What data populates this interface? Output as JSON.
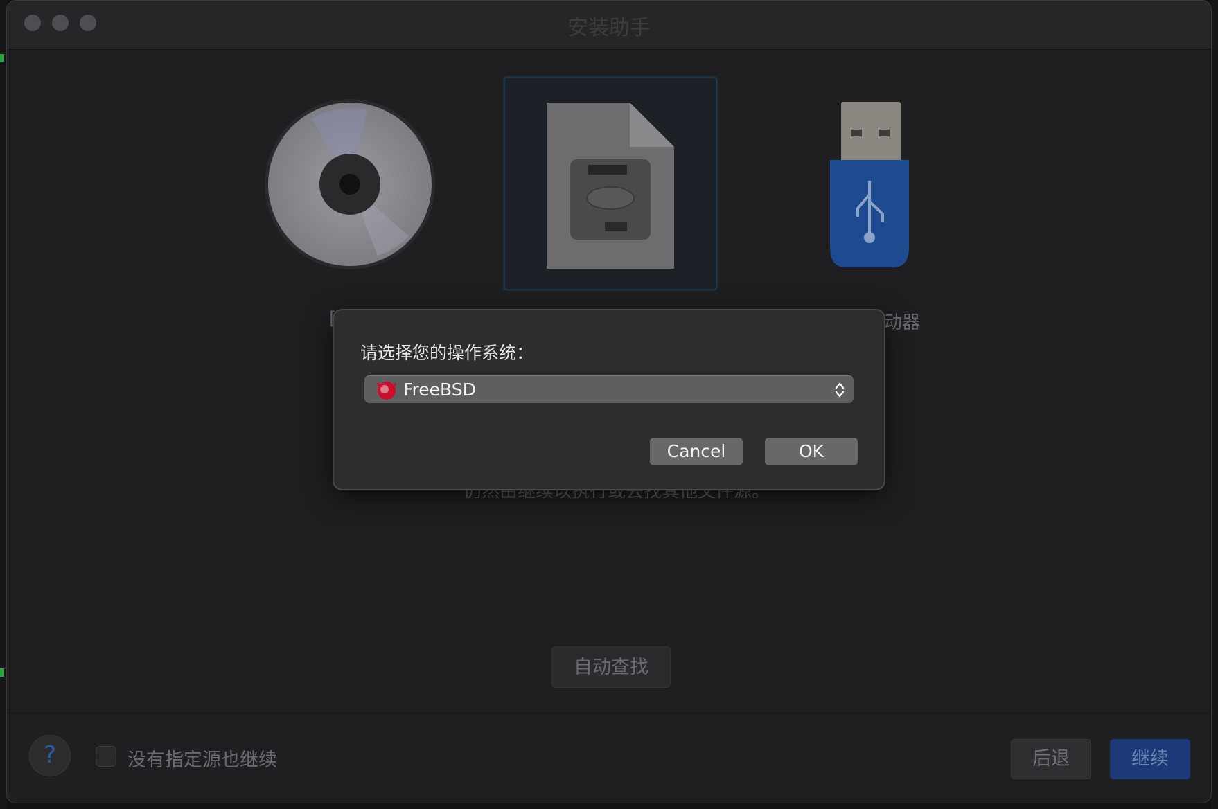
{
  "window": {
    "title": "安装助手"
  },
  "sources": {
    "disc": {
      "label_fragment": "["
    },
    "image_file": {
      "selected": true
    },
    "usb": {
      "label_fragment": "动器"
    }
  },
  "hint_text": "仍然由继续以执行或去找其他文件源。",
  "auto_find_label": "自动查找",
  "footer": {
    "help_label": "?",
    "checkbox_label": "没有指定源也继续",
    "checkbox_checked": false,
    "back_label": "后退",
    "continue_label": "继续"
  },
  "dialog": {
    "prompt": "请选择您的操作系统：",
    "selected_os": "FreeBSD",
    "os_icon": "freebsd-logo-icon",
    "cancel_label": "Cancel",
    "ok_label": "OK"
  },
  "colors": {
    "accent_blue": "#1c3a78",
    "freebsd_red": "#c8102e"
  }
}
